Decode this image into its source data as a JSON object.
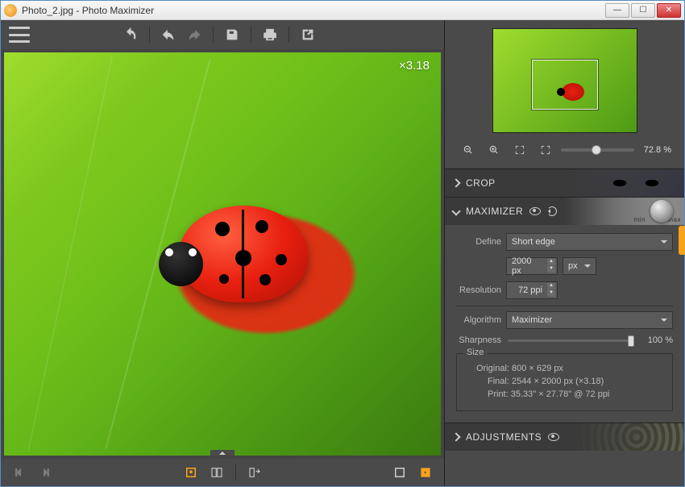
{
  "window": {
    "title": "Photo_2.jpg - Photo Maximizer"
  },
  "viewport": {
    "zoom_label": "×3.18"
  },
  "navigator": {
    "zoom_percent": "72.8 %"
  },
  "panels": {
    "crop": {
      "title": "CROP"
    },
    "maximizer": {
      "title": "MAXIMIZER",
      "dial_min": "min",
      "dial_max": "max",
      "define_label": "Define",
      "define_value": "Short edge",
      "size_value": "2000 px",
      "unit_value": "px",
      "resolution_label": "Resolution",
      "resolution_value": "72 ppi",
      "algorithm_label": "Algorithm",
      "algorithm_value": "Maximizer",
      "sharpness_label": "Sharpness",
      "sharpness_value": "100 %",
      "size_section_label": "Size",
      "size_original": "Original: 800 × 629 px",
      "size_final": "Final: 2544 × 2000 px (×3.18)",
      "size_print": "Print: 35.33\" × 27.78\" @ 72 ppi"
    },
    "adjustments": {
      "title": "ADJUSTMENTS"
    }
  }
}
